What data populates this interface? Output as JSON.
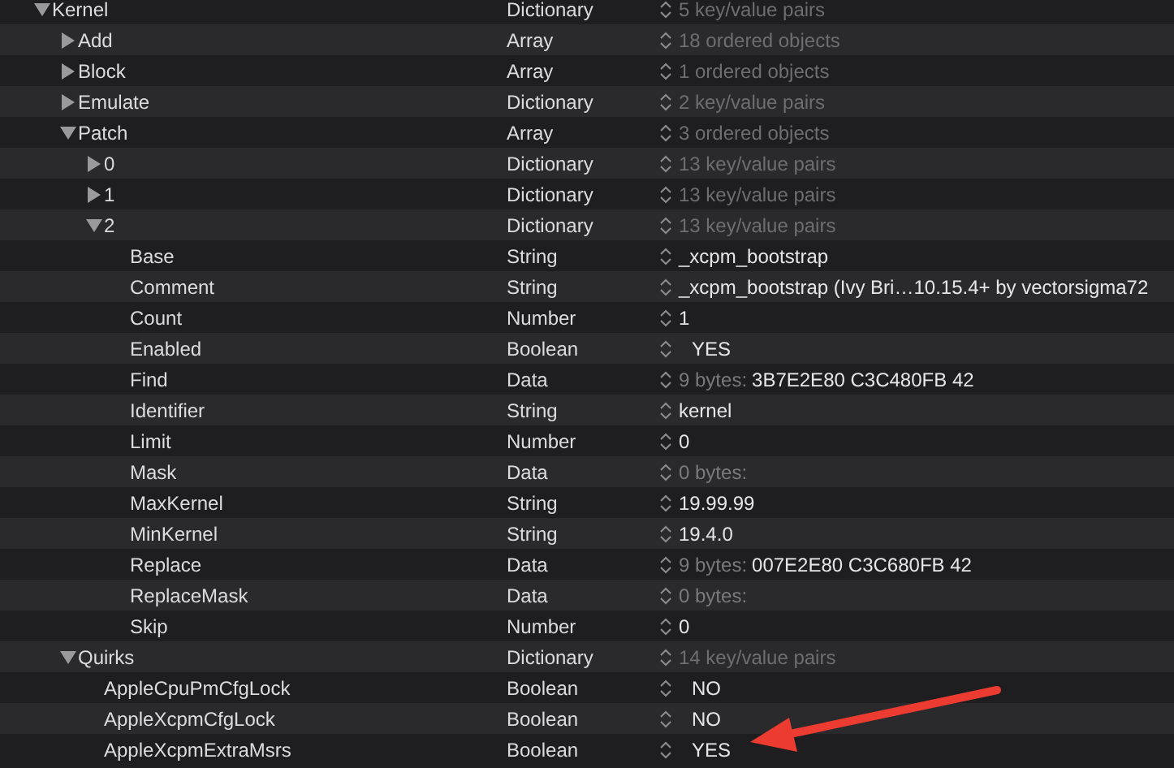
{
  "tree": [
    {
      "key": "Kernel",
      "type": "Dictionary",
      "kind": "summary",
      "value": "5 key/value pairs",
      "expanded": true,
      "children": [
        {
          "key": "Add",
          "type": "Array",
          "kind": "summary",
          "value": "18 ordered objects",
          "expanded": false
        },
        {
          "key": "Block",
          "type": "Array",
          "kind": "summary",
          "value": "1 ordered objects",
          "expanded": false
        },
        {
          "key": "Emulate",
          "type": "Dictionary",
          "kind": "summary",
          "value": "2 key/value pairs",
          "expanded": false
        },
        {
          "key": "Patch",
          "type": "Array",
          "kind": "summary",
          "value": "3 ordered objects",
          "expanded": true,
          "children": [
            {
              "key": "0",
              "type": "Dictionary",
              "kind": "summary",
              "value": "13 key/value pairs",
              "expanded": false
            },
            {
              "key": "1",
              "type": "Dictionary",
              "kind": "summary",
              "value": "13 key/value pairs",
              "expanded": false
            },
            {
              "key": "2",
              "type": "Dictionary",
              "kind": "summary",
              "value": "13 key/value pairs",
              "expanded": true,
              "children": [
                {
                  "key": "Base",
                  "type": "String",
                  "kind": "text",
                  "value": "_xcpm_bootstrap"
                },
                {
                  "key": "Comment",
                  "type": "String",
                  "kind": "text",
                  "value": "_xcpm_bootstrap (Ivy Bri…10.15.4+ by vectorsigma72"
                },
                {
                  "key": "Count",
                  "type": "Number",
                  "kind": "text",
                  "value": "1"
                },
                {
                  "key": "Enabled",
                  "type": "Boolean",
                  "kind": "boolean",
                  "value": "YES"
                },
                {
                  "key": "Find",
                  "type": "Data",
                  "kind": "data",
                  "prefix": "9 bytes:",
                  "value": "3B7E2E80 C3C480FB 42"
                },
                {
                  "key": "Identifier",
                  "type": "String",
                  "kind": "text",
                  "value": "kernel"
                },
                {
                  "key": "Limit",
                  "type": "Number",
                  "kind": "text",
                  "value": "0"
                },
                {
                  "key": "Mask",
                  "type": "Data",
                  "kind": "data",
                  "prefix": "0 bytes:"
                },
                {
                  "key": "MaxKernel",
                  "type": "String",
                  "kind": "text",
                  "value": "19.99.99"
                },
                {
                  "key": "MinKernel",
                  "type": "String",
                  "kind": "text",
                  "value": "19.4.0"
                },
                {
                  "key": "Replace",
                  "type": "Data",
                  "kind": "data",
                  "prefix": "9 bytes:",
                  "value": "007E2E80 C3C680FB 42"
                },
                {
                  "key": "ReplaceMask",
                  "type": "Data",
                  "kind": "data",
                  "prefix": "0 bytes:"
                },
                {
                  "key": "Skip",
                  "type": "Number",
                  "kind": "text",
                  "value": "0"
                }
              ]
            }
          ]
        },
        {
          "key": "Quirks",
          "type": "Dictionary",
          "kind": "summary",
          "value": "14 key/value pairs",
          "expanded": true,
          "children": [
            {
              "key": "AppleCpuPmCfgLock",
              "type": "Boolean",
              "kind": "boolean",
              "value": "NO"
            },
            {
              "key": "AppleXcpmCfgLock",
              "type": "Boolean",
              "kind": "boolean",
              "value": "NO"
            },
            {
              "key": "AppleXcpmExtraMsrs",
              "type": "Boolean",
              "kind": "boolean",
              "value": "YES"
            }
          ]
        }
      ]
    }
  ]
}
